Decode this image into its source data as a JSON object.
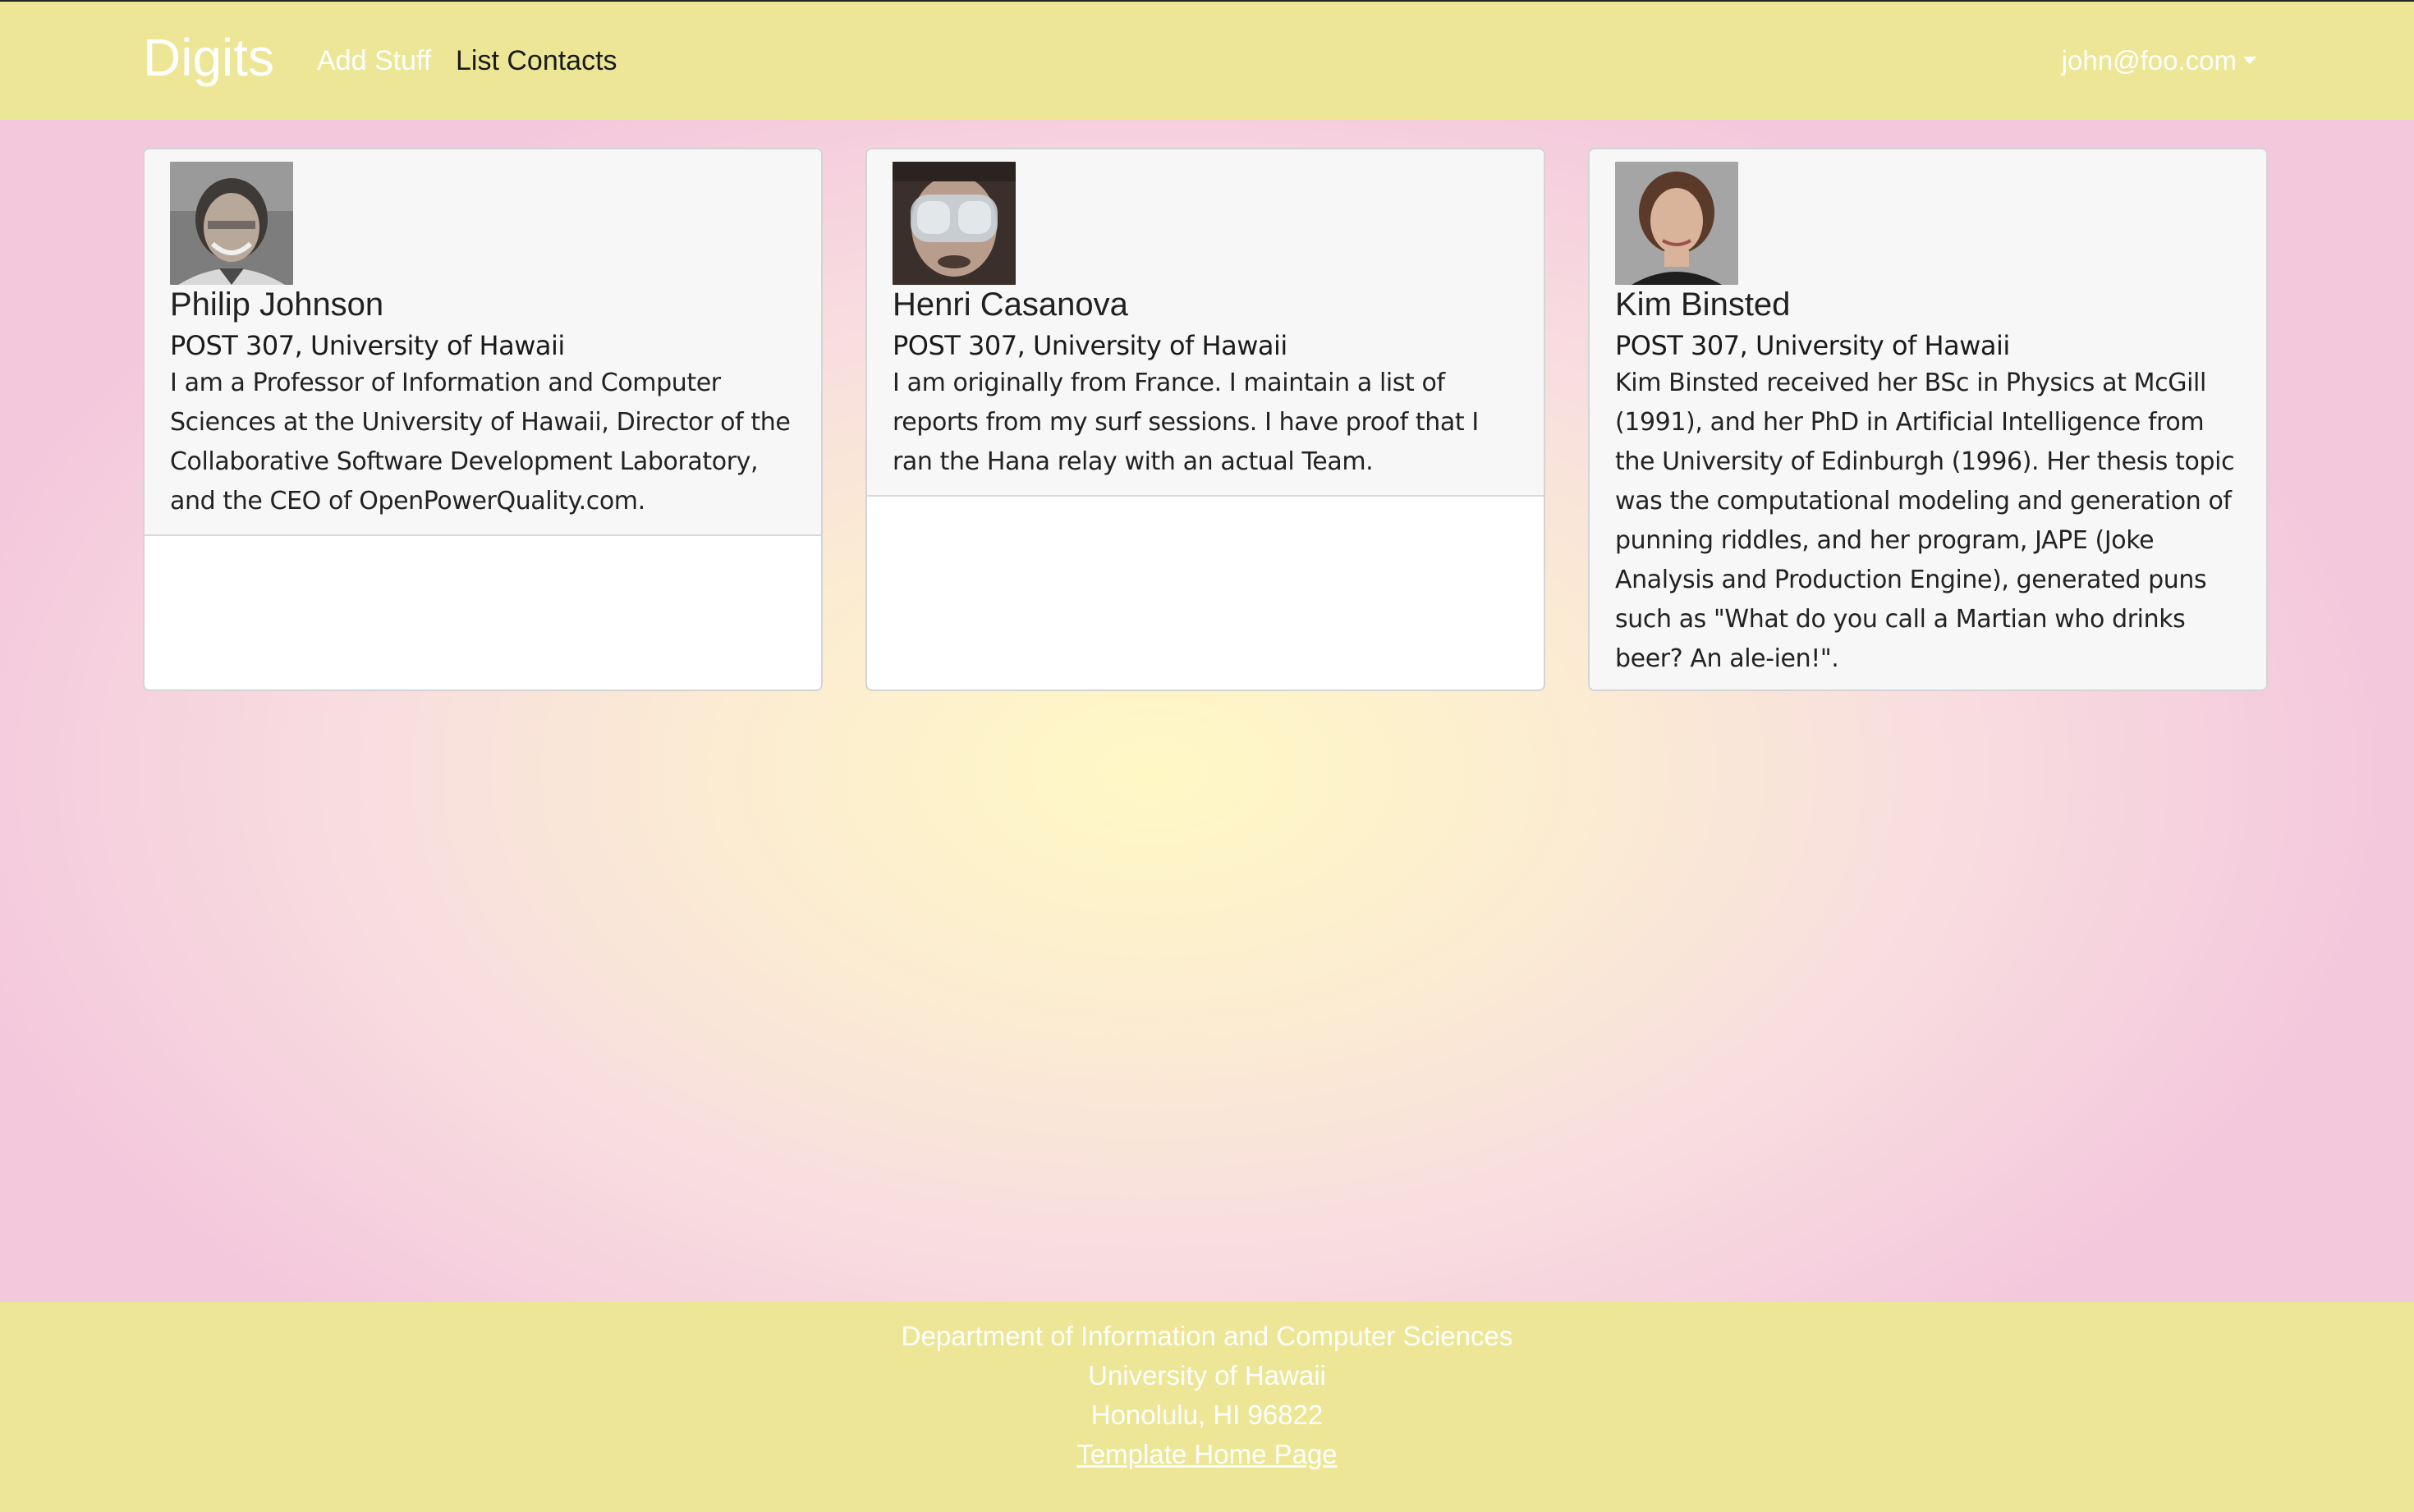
{
  "navbar": {
    "brand": "Digits",
    "links": [
      {
        "label": "Add Stuff",
        "active": false
      },
      {
        "label": "List Contacts",
        "active": true
      }
    ],
    "user": "john@foo.com"
  },
  "contacts": [
    {
      "name": "Philip Johnson",
      "address": "POST 307, University of Hawaii",
      "description": "I am a Professor of Information and Computer Sciences at the University of Hawaii, Director of the Collaborative Software Development Laboratory, and the CEO of OpenPowerQuality.com."
    },
    {
      "name": "Henri Casanova",
      "address": "POST 307, University of Hawaii",
      "description": "I am originally from France. I maintain a list of reports from my surf sessions. I have proof that I ran the Hana relay with an actual Team."
    },
    {
      "name": "Kim Binsted",
      "address": "POST 307, University of Hawaii",
      "description": "Kim Binsted received her BSc in Physics at McGill (1991), and her PhD in Artificial Intelligence from the University of Edinburgh (1996). Her thesis topic was the computational modeling and generation of punning riddles, and her program, JAPE (Joke Analysis and Production Engine), generated puns such as \"What do you call a Martian who drinks beer? An ale-ien!\"."
    }
  ],
  "footer": {
    "line1": "Department of Information and Computer Sciences",
    "line2": "University of Hawaii",
    "line3": "Honolulu, HI 96822",
    "link": "Template Home Page"
  },
  "colors": {
    "navbar_bg": "#ede696",
    "footer_bg": "#ede696",
    "card_header_bg": "#f7f7f7"
  }
}
